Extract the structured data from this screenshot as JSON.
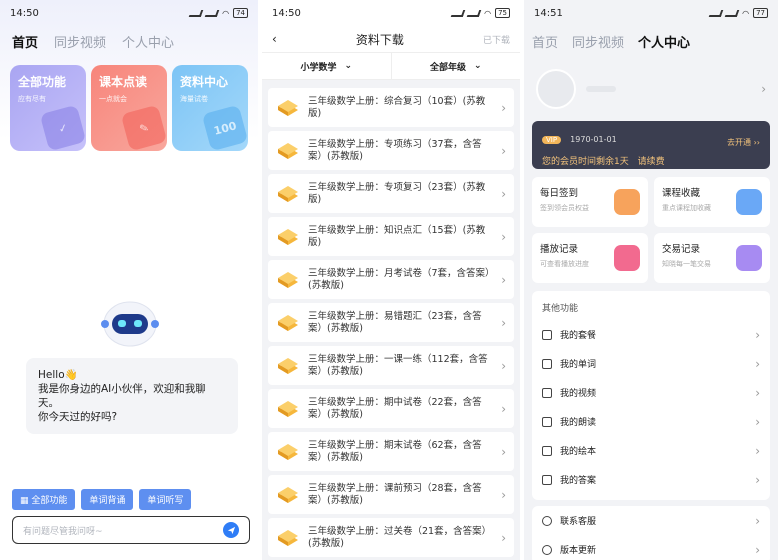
{
  "phone1": {
    "status": {
      "time": "14:50",
      "battery": "74"
    },
    "tabs": [
      "首页",
      "同步视频",
      "个人中心"
    ],
    "cards": [
      {
        "title": "全部功能",
        "subtitle": "应有尽有"
      },
      {
        "title": "课本点读",
        "subtitle": "一点就会"
      },
      {
        "title": "资料中心",
        "subtitle": "海量试卷",
        "deco": "100"
      }
    ],
    "bubble": {
      "line1": "Hello👋",
      "line2": "我是你身边的AI小伙伴，欢迎和我聊天。",
      "line3": "你今天过的好吗?"
    },
    "quick_buttons": [
      "全部功能",
      "单词背诵",
      "单词听写"
    ],
    "input_placeholder": "有问题尽管我问呀~"
  },
  "phone2": {
    "status": {
      "time": "14:50",
      "battery": "75"
    },
    "title": "资料下载",
    "right_action": "已下载",
    "filters": [
      "小学数学",
      "全部年级"
    ],
    "items": [
      "三年级数学上册：综合复习（10套）(苏教版)",
      "三年级数学上册：专项练习（37套，含答案）(苏教版)",
      "三年级数学上册：专项复习（23套）(苏教版)",
      "三年级数学上册：知识点汇（15套）(苏教版)",
      "三年级数学上册：月考试卷（7套，含答案）(苏教版)",
      "三年级数学上册：易错题汇（23套，含答案）(苏教版)",
      "三年级数学上册：一课一练（112套，含答案）(苏教版)",
      "三年级数学上册：期中试卷（22套，含答案）(苏教版)",
      "三年级数学上册：期末试卷（62套，含答案）(苏教版)",
      "三年级数学上册：课前预习（28套，含答案）(苏教版)",
      "三年级数学上册：过关卷（21套，含答案）(苏教版)"
    ]
  },
  "phone3": {
    "status": {
      "time": "14:51",
      "battery": "77"
    },
    "tabs": [
      "首页",
      "同步视频",
      "个人中心"
    ],
    "vip": {
      "badge": "VIP",
      "date": "1970-01-01",
      "text": "您的会员时间剩余1天",
      "renew": "请续费",
      "action": "去开通"
    },
    "grid": [
      {
        "title": "每日签到",
        "subtitle": "签到领会员权益",
        "color": "#f7a35c"
      },
      {
        "title": "课程收藏",
        "subtitle": "重点课程加收藏",
        "color": "#6aa8f6"
      },
      {
        "title": "播放记录",
        "subtitle": "可查看播放进度",
        "color": "#f26a8f"
      },
      {
        "title": "交易记录",
        "subtitle": "知晓每一笔交易",
        "color": "#a78bf2"
      }
    ],
    "other_title": "其他功能",
    "other_items": [
      "我的套餐",
      "我的单词",
      "我的视频",
      "我的朗读",
      "我的绘本",
      "我的答案"
    ],
    "bottom_items": [
      "联系客服",
      "版本更新"
    ]
  }
}
